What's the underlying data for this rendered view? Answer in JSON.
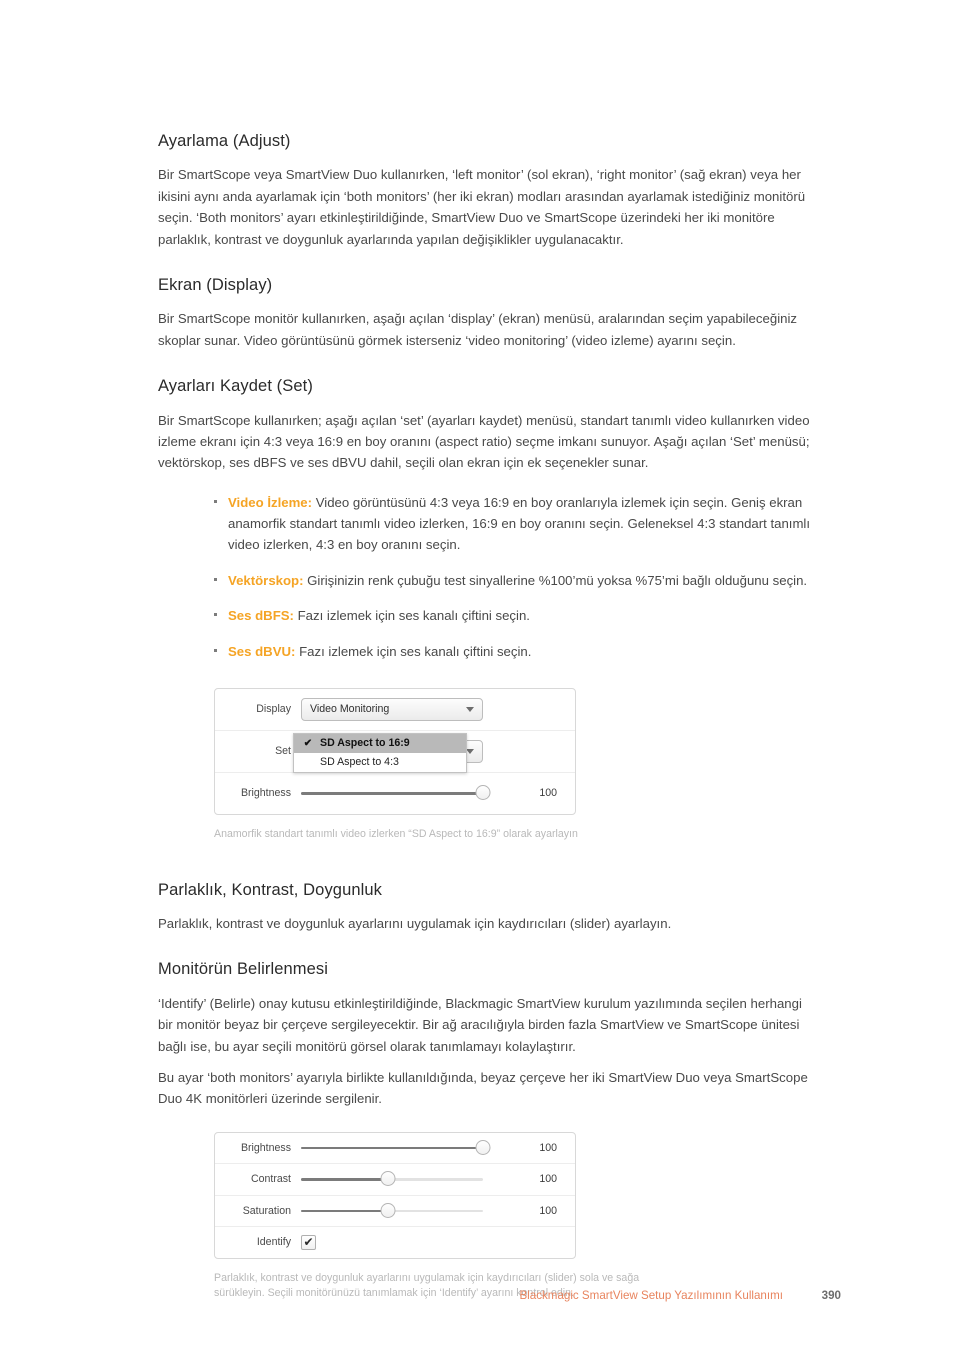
{
  "sections": [
    {
      "heading": "Ayarlama (Adjust)",
      "paragraphs": [
        "Bir SmartScope veya SmartView Duo kullanırken, ‘left monitor’ (sol ekran), ‘right monitor’ (sağ ekran) veya her ikisini aynı anda ayarlamak için ‘both monitors’ (her iki ekran) modları arasından ayarlamak istediğiniz monitörü seçin. ‘Both monitors’ ayarı etkinleştirildiğinde, SmartView Duo ve SmartScope üzerindeki her iki monitöre parlaklık, kontrast ve doygunluk ayarlarında yapılan değişiklikler uygulanacaktır."
      ]
    },
    {
      "heading": "Ekran (Display)",
      "paragraphs": [
        "Bir SmartScope monitör kullanırken, aşağı açılan ‘display’ (ekran) menüsü, aralarından seçim yapabileceğiniz skoplar sunar. Video görüntüsünü görmek isterseniz ‘video monitoring’ (video izleme) ayarını seçin."
      ]
    },
    {
      "heading": "Ayarları Kaydet (Set)",
      "paragraphs": [
        "Bir SmartScope kullanırken; aşağı açılan ‘set’ (ayarları kaydet) menüsü, standart tanımlı video kullanırken video izleme ekranı için 4:3 veya 16:9 en boy oranını (aspect ratio) seçme imkanı sunuyor. Aşağı açılan ‘Set’ menüsü; vektörskop, ses dBFS ve ses dBVU dahil, seçili olan ekran için ek seçenekler sunar."
      ]
    }
  ],
  "bullets": [
    {
      "label": "Video İzleme:",
      "text": " Video görüntüsünü 4:3 veya 16:9 en boy oranlarıyla izlemek için seçin. Geniş ekran anamorfik standart tanımlı video izlerken, 16:9 en boy oranını seçin. Geleneksel 4:3 standart tanımlı video izlerken, 4:3 en boy oranını seçin."
    },
    {
      "label": "Vektörskop:",
      "text": " Girişinizin renk çubuğu test sinyallerine %100’mü yoksa %75’mi bağlı olduğunu seçin."
    },
    {
      "label": "Ses dBFS:",
      "text": " Fazı izlemek için ses kanalı çiftini seçin."
    },
    {
      "label": "Ses dBVU:",
      "text": " Fazı izlemek için ses kanalı çiftini seçin."
    }
  ],
  "figure_display": {
    "display_label": "Display",
    "display_value": "Video Monitoring",
    "set_label": "Set",
    "menu_items": [
      {
        "label": "SD Aspect to 16:9",
        "checked": "✔"
      },
      {
        "label": "SD Aspect to 4:3",
        "checked": ""
      }
    ],
    "brightness_label": "Brightness",
    "brightness_value": "100",
    "caption": "Anamorfik standart tanımlı video izlerken “SD Aspect to 16:9” olarak ayarlayın"
  },
  "sections_lower": [
    {
      "heading": "Parlaklık, Kontrast, Doygunluk",
      "paragraphs": [
        "Parlaklık, kontrast ve doygunluk ayarlarını uygulamak için kaydırıcıları (slider) ayarlayın."
      ]
    },
    {
      "heading": "Monitörün Belirlenmesi",
      "paragraphs": [
        "‘Identify’ (Belirle) onay kutusu etkinleştirildiğinde, Blackmagic SmartView kurulum yazılımında seçilen herhangi bir monitör beyaz bir çerçeve sergileyecektir. Bir ağ aracılığıyla birden fazla SmartView ve SmartScope ünitesi bağlı ise, bu ayar seçili monitörü görsel olarak tanımlamayı kolaylaştırır.",
        "Bu ayar ‘both monitors’ ayarıyla birlikte kullanıldığında, beyaz çerçeve her iki SmartView Duo veya SmartScope Duo 4K monitörleri üzerinde sergilenir."
      ]
    }
  ],
  "figure_sliders": {
    "rows": [
      {
        "label": "Brightness",
        "value": "100"
      },
      {
        "label": "Contrast",
        "value": "100"
      },
      {
        "label": "Saturation",
        "value": "100"
      }
    ],
    "identify_label": "Identify",
    "identify_check": "✔",
    "caption": "Parlaklık, kontrast ve doygunluk ayarlarını uygulamak için kaydırıcıları (slider) sola ve sağa sürükleyin. Seçili monitörünüzü tanımlamak için ‘Identify’ ayarını kontrol edin."
  },
  "footer": {
    "title": "Blackmagic SmartView Setup Yazılımının Kullanımı",
    "page": "390"
  }
}
